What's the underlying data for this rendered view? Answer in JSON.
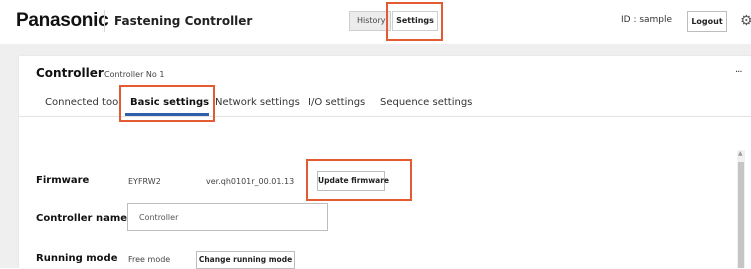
{
  "header": {
    "logo": "Panasonic",
    "app_title": "Fastening Controller",
    "nav": {
      "history_label": "History",
      "settings_label": "Settings"
    },
    "user_id": "ID : sample",
    "logout_label": "Logout",
    "settings_icon": "gear-icon"
  },
  "card": {
    "title": "Controller",
    "subtitle": "Controller No 1",
    "more_label": "..."
  },
  "tabs": [
    {
      "label": "Connected tool"
    },
    {
      "label": "Basic settings",
      "active": true
    },
    {
      "label": "Network settings"
    },
    {
      "label": "I/O settings"
    },
    {
      "label": "Sequence settings"
    }
  ],
  "firmware": {
    "label": "Firmware",
    "name": "EYFRW2",
    "version": "ver.qh0101r_00.01.13",
    "update_label": "Update firmware"
  },
  "controller_name": {
    "label": "Controller name",
    "value": "Controller"
  },
  "running_mode": {
    "label": "Running mode",
    "value": "Free mode",
    "change_label": "Change running mode"
  },
  "colors": {
    "highlight": "#e45a33",
    "tab_underline": "#2f5fa8",
    "background": "#efefef"
  }
}
